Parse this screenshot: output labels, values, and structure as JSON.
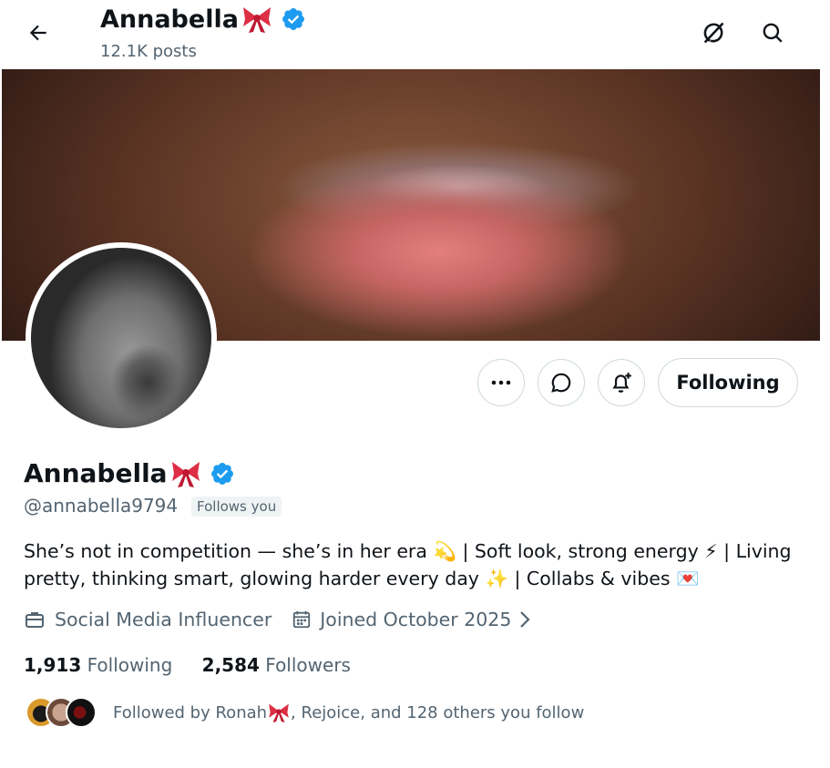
{
  "header": {
    "display_name": "Annabella",
    "posts": "12.1K posts"
  },
  "profile": {
    "display_name": "Annabella",
    "handle": "@annabella9794",
    "follows_you": "Follows you",
    "bio": "She’s not in competition — she’s in her era 💫 | Soft look, strong energy ⚡ | Living pretty, thinking smart, glowing harder every day ✨ | Collabs & vibes 💌",
    "category": "Social Media Influencer",
    "joined": "Joined October 2025",
    "following_count": "1,913",
    "following_label": "Following",
    "followers_count": "2,584",
    "followers_label": "Followers",
    "followed_by_prefix": "Followed by Ronah",
    "followed_by_suffix": ", Rejoice, and 128 others you follow"
  },
  "actions": {
    "following_button": "Following"
  },
  "colors": {
    "verified": "#1d9bf0",
    "bow": "#e0245e",
    "secondary_text": "#536471"
  }
}
